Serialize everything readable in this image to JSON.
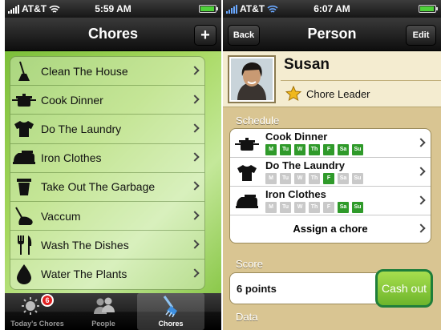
{
  "screen1": {
    "status": {
      "carrier": "AT&T",
      "time": "5:59 AM"
    },
    "nav": {
      "title": "Chores",
      "add_label": "+"
    },
    "chores": [
      {
        "label": "Clean The House",
        "icon": "broom-icon"
      },
      {
        "label": "Cook Dinner",
        "icon": "pot-icon"
      },
      {
        "label": "Do The Laundry",
        "icon": "tshirt-icon"
      },
      {
        "label": "Iron Clothes",
        "icon": "iron-icon"
      },
      {
        "label": "Take Out The Garbage",
        "icon": "trash-can-icon"
      },
      {
        "label": "Vaccum",
        "icon": "vacuum-icon"
      },
      {
        "label": "Wash The Dishes",
        "icon": "fork-knife-icon"
      },
      {
        "label": "Water The Plants",
        "icon": "water-drop-icon"
      }
    ],
    "tabs": [
      {
        "label": "Today's Chores",
        "badge": "6",
        "icon": "sun-icon"
      },
      {
        "label": "People",
        "icon": "people-icon"
      },
      {
        "label": "Chores",
        "icon": "brush-icon"
      }
    ]
  },
  "screen2": {
    "status": {
      "carrier": "AT&T",
      "time": "6:07 AM"
    },
    "nav": {
      "title": "Person",
      "back_label": "Back",
      "edit_label": "Edit"
    },
    "person": {
      "name": "Susan",
      "role": "Chore Leader",
      "role_icon": "star-icon"
    },
    "schedule_label": "Schedule",
    "day_letters": [
      "M",
      "Tu",
      "W",
      "Th",
      "F",
      "Sa",
      "Su"
    ],
    "schedule": [
      {
        "chore": "Cook Dinner",
        "icon": "pot-icon",
        "days": [
          true,
          true,
          true,
          true,
          true,
          true,
          true
        ]
      },
      {
        "chore": "Do The Laundry",
        "icon": "tshirt-icon",
        "days": [
          false,
          false,
          false,
          false,
          true,
          false,
          false
        ]
      },
      {
        "chore": "Iron Clothes",
        "icon": "iron-icon",
        "days": [
          false,
          false,
          false,
          false,
          false,
          true,
          true
        ]
      }
    ],
    "assign_label": "Assign a chore",
    "score_label": "Score",
    "score_value": "6 points",
    "cash_out_label": "Cash out",
    "data_label": "Data"
  },
  "colors": {
    "day_on": "#2f9a2a",
    "day_off": "#c9c9c9",
    "cash_out": "#8bcb3c",
    "chore_bg": "#a6d85e"
  }
}
